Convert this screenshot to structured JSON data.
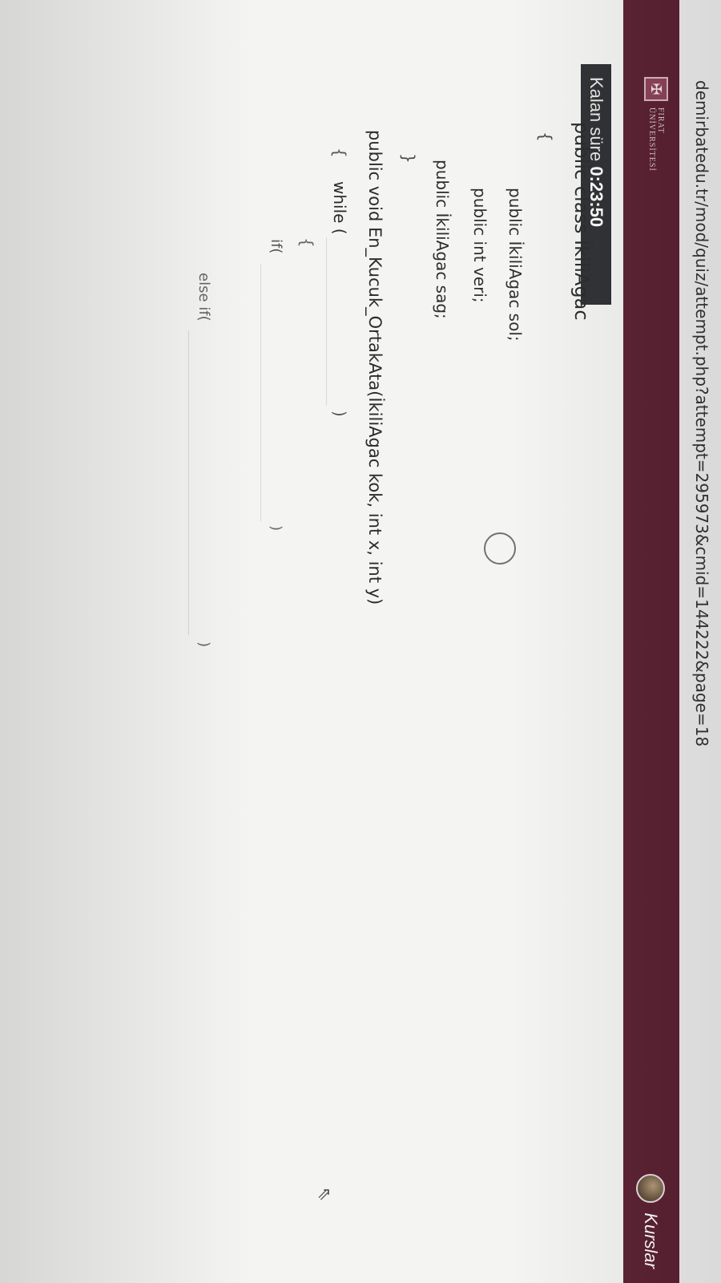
{
  "browser": {
    "url": "demirbatedu.tr/mod/quiz/attempt.php?attempt=295973&cmid=144222&page=18"
  },
  "navbar": {
    "logo_line1": "FIRAT",
    "logo_line2": "ÜNİVERSİTESİ",
    "link": "Kurslar"
  },
  "quiz": {
    "timer_label": "Kalan süre",
    "timer_value": "0:23:50"
  },
  "code": {
    "line1": "public class İkiliAgac",
    "line2": "{",
    "line3": "public İkiliAgac sol;",
    "line4": "public int veri;",
    "line5": "public İkiliAgac sag;",
    "line6": "}",
    "line7": "public void En_Kucuk_OrtakAta(İkiliAgac kok, int x, int y)",
    "line8_open": "{",
    "line8_kw": "while (",
    "line8_close": ")",
    "line9": "{",
    "line10_kw": "if(",
    "line10_close": ")",
    "line11_kw": "else if(",
    "line11_close": ")"
  }
}
